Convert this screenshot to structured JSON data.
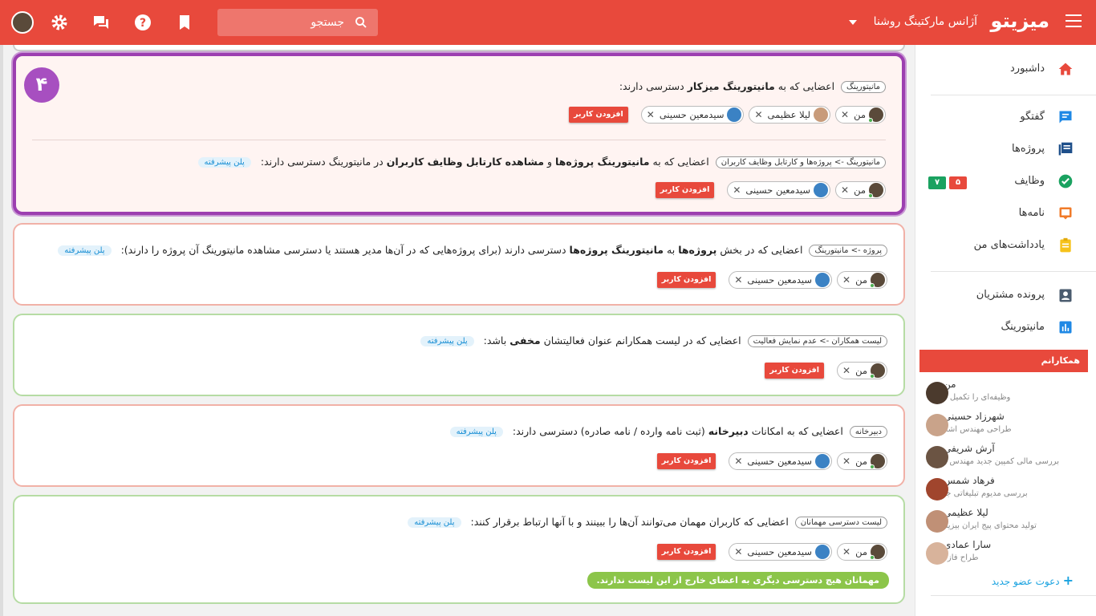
{
  "topbar": {
    "brand": "میزیتو",
    "org_name": "آژانس مارکتینگ روشنا",
    "search_placeholder": "جستجو"
  },
  "sidebar": {
    "items": [
      {
        "label": "داشبورد",
        "icon": "home-icon"
      },
      {
        "label": "گفتگو",
        "icon": "chat-icon"
      },
      {
        "label": "پروژه‌ها",
        "icon": "projects-icon"
      },
      {
        "label": "وظایف",
        "icon": "tasks-icon"
      },
      {
        "label": "نامه‌ها",
        "icon": "letters-icon"
      },
      {
        "label": "یادداشت‌های من",
        "icon": "notes-icon"
      },
      {
        "label": "پرونده مشتریان",
        "icon": "customers-icon"
      },
      {
        "label": "مانیتورینگ",
        "icon": "monitoring-icon"
      }
    ],
    "task_badges": {
      "green": "۷",
      "red": "۵"
    },
    "colleagues_title": "همکارانم",
    "colleagues": [
      {
        "name": "من",
        "desc": "وظیفه‌ای را تکمیل کرد"
      },
      {
        "name": "شهرزاد حسینی",
        "desc": "طراحی مهندس اشکان"
      },
      {
        "name": "آرش شریفی",
        "desc": "بررسی مالی کمپین جدید مهندس ز..."
      },
      {
        "name": "فرهاد شمس",
        "desc": "بررسی مدیوم تبلیغاتی جدید"
      },
      {
        "name": "لیلا عظیمی",
        "desc": "تولید محتوای پیج ایران بیزینس"
      },
      {
        "name": "سارا عمادی",
        "desc": "طراح فاز یک"
      }
    ],
    "invite": "دعوت عضو جدید"
  },
  "common": {
    "add_user": "افزودن کاربر",
    "plan": "پلن پیشرفته",
    "me": "من",
    "seyed": "سیدمعین حسینی",
    "leila": "لیلا عظیمی"
  },
  "step": "۴",
  "cards": {
    "c1a": {
      "tag": "مانیتورینگ",
      "pre": "اعضایی که به",
      "bold": "مانیتورینگ میزکار",
      "post": "دسترسی دارند:"
    },
    "c1b": {
      "tag": "مانیتورینگ -> پروژه‌ها و کارتابل وظایف کاربران",
      "pre": "اعضایی که به",
      "bold1": "مانیتورینگ پروژه‌ها",
      "mid": "و",
      "bold2": "مشاهده کارتابل وظایف کاربران",
      "post": "در مانیتورینگ دسترسی دارند:"
    },
    "c2": {
      "tag": "پروژه -> مانیتورینگ",
      "pre": "اعضایی که در بخش",
      "bold1": "پروژه‌ها",
      "mid": "به",
      "bold2": "مانیتورینگ پروژه‌ها",
      "post": "دسترسی دارند (برای پروژه‌هایی که در آن‌ها مدیر هستند یا دسترسی مشاهده مانیتورینگ آن پروژه را دارند):"
    },
    "c3": {
      "tag": "لیست همکاران -> عدم نمایش فعالیت",
      "pre": "اعضایی که در لیست همکارانم عنوان فعالیتشان",
      "bold": "مخفی",
      "post": "باشد:"
    },
    "c4": {
      "tag": "دبیرخانه",
      "pre": "اعضایی که به امکانات",
      "bold": "دبیرخانه",
      "post": "(ثبت نامه وارده / نامه صادره) دسترسی دارند:"
    },
    "c5": {
      "tag": "لیست دسترسی مهمانان",
      "text": "اعضایی که کاربران مهمان می‌توانند آن‌ها را ببینند و با آنها ارتباط برقرار کنند:",
      "note": "مهمانان هیچ دسترسی دیگری به اعضای خارج از این لیست ندارند."
    }
  },
  "colors": {
    "primary": "#e8493c",
    "highlight": "#9c3fb0",
    "green": "#8cc54a",
    "plan": "#1a8fd4"
  }
}
